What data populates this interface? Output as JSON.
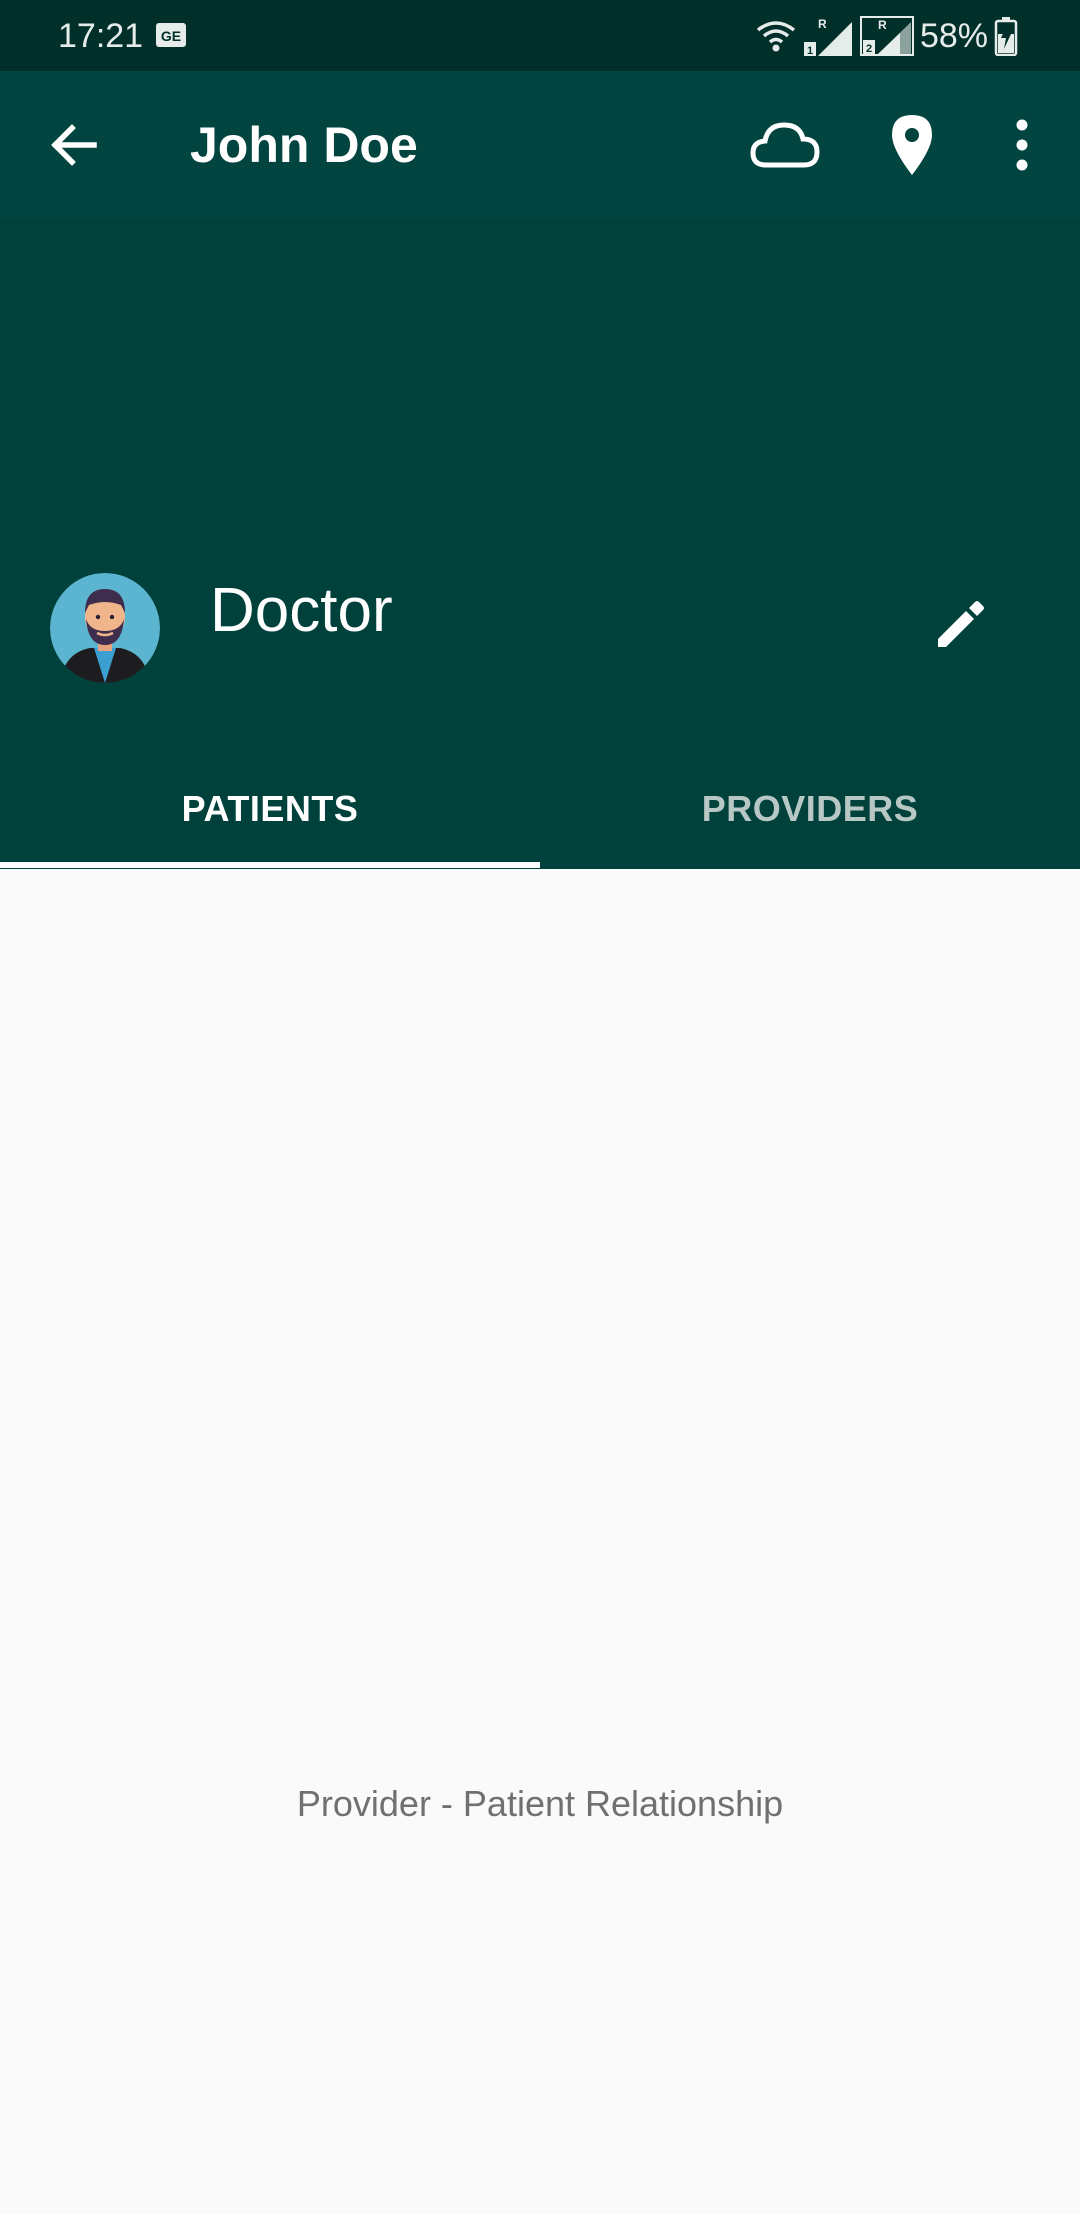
{
  "status_bar": {
    "time": "17:21",
    "battery": "58%"
  },
  "app_bar": {
    "title": "John Doe",
    "icons": [
      "back-icon",
      "cloud-icon",
      "location-pin-icon",
      "more-vert-icon"
    ]
  },
  "profile": {
    "role": "Doctor"
  },
  "tabs": [
    {
      "label": "PATIENTS",
      "selected": true
    },
    {
      "label": "PROVIDERS",
      "selected": false
    }
  ],
  "content": {
    "empty_message": "Provider - Patient Relationship"
  },
  "colors": {
    "status_bar": "#01302b",
    "app_bar": "#024540",
    "header": "#00413b",
    "background": "#fafafa",
    "text_muted": "#707070"
  }
}
